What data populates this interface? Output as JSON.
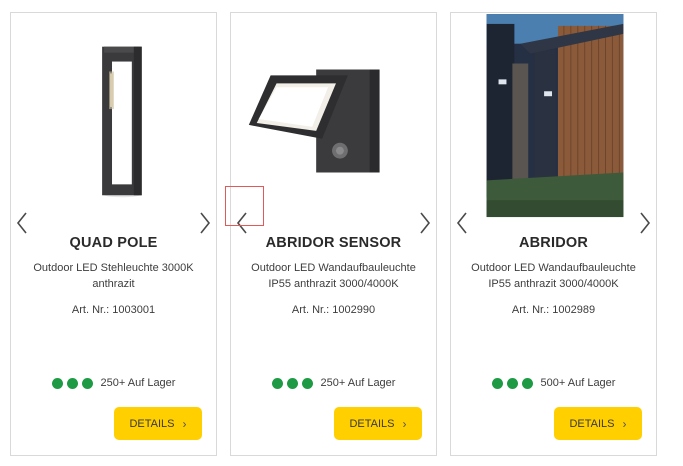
{
  "products": [
    {
      "title": "QUAD POLE",
      "desc_line1": "Outdoor LED Stehleuchte 3000K",
      "desc_line2": "anthrazit",
      "art_nr": "Art. Nr.: 1003001",
      "stock": "250+ Auf Lager",
      "details_label": "DETAILS"
    },
    {
      "title": "ABRIDOR SENSOR",
      "desc_line1": "Outdoor LED Wandaufbauleuchte",
      "desc_line2": "IP55 anthrazit 3000/4000K",
      "art_nr": "Art. Nr.: 1002990",
      "stock": "250+ Auf Lager",
      "details_label": "DETAILS"
    },
    {
      "title": "ABRIDOR",
      "desc_line1": "Outdoor LED Wandaufbauleuchte",
      "desc_line2": "IP55 anthrazit 3000/4000K",
      "art_nr": "Art. Nr.: 1002989",
      "stock": "500+ Auf Lager",
      "details_label": "DETAILS"
    }
  ],
  "icons": {
    "prev": "chevron-left-icon",
    "next": "chevron-right-icon",
    "details_arrow": "chevron-right-icon"
  },
  "colors": {
    "button_bg": "#ffcf00",
    "stock_dot": "#1e9a44",
    "highlight_border": "#e05a5a",
    "card_border": "#d9d9d9"
  }
}
